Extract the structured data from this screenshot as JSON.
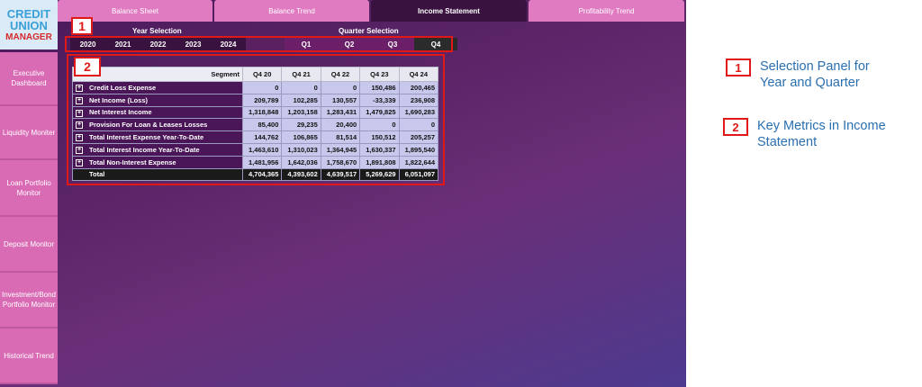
{
  "logo": {
    "line1": "CREDIT",
    "line2": "UNION",
    "line3": "MANAGER"
  },
  "tabs": [
    {
      "label": "Balance Sheet",
      "active": false
    },
    {
      "label": "Balance Trend",
      "active": false
    },
    {
      "label": "Income Statement",
      "active": true
    },
    {
      "label": "Profitability Trend",
      "active": false
    }
  ],
  "sidebar": [
    {
      "label": "Executive Dashboard"
    },
    {
      "label": "Liquidity Moniter"
    },
    {
      "label": "Loan Portfolio Monitor"
    },
    {
      "label": "Deposit Monitor"
    },
    {
      "label": "Investment/Bond Portfolio Monitor"
    },
    {
      "label": "Historical Trend"
    }
  ],
  "selection": {
    "year_title": "Year Selection",
    "quarter_title": "Quarter Selection",
    "years": [
      "2020",
      "2021",
      "2022",
      "2023",
      "2024"
    ],
    "quarters": [
      "Q1",
      "Q2",
      "Q3",
      "Q4"
    ],
    "selected_quarter": "Q4"
  },
  "callouts": {
    "one": "1",
    "two": "2"
  },
  "table": {
    "segment_header": "Segment",
    "columns": [
      "Q4 20",
      "Q4 21",
      "Q4 22",
      "Q4 23",
      "Q4 24"
    ],
    "rows": [
      {
        "label": "Credit Loss Expense",
        "values": [
          "0",
          "0",
          "0",
          "150,486",
          "200,465"
        ]
      },
      {
        "label": "Net Income (Loss)",
        "values": [
          "209,789",
          "102,285",
          "130,557",
          "-33,339",
          "236,908"
        ]
      },
      {
        "label": "Net Interest Income",
        "values": [
          "1,318,848",
          "1,203,158",
          "1,283,431",
          "1,479,825",
          "1,690,283"
        ]
      },
      {
        "label": "Provision For Loan & Leases Losses",
        "values": [
          "85,400",
          "29,235",
          "20,400",
          "0",
          "0"
        ]
      },
      {
        "label": "Total Interest Expense Year-To-Date",
        "values": [
          "144,762",
          "106,865",
          "81,514",
          "150,512",
          "205,257"
        ]
      },
      {
        "label": "Total Interest Income Year-To-Date",
        "values": [
          "1,463,610",
          "1,310,023",
          "1,364,945",
          "1,630,337",
          "1,895,540"
        ]
      },
      {
        "label": "Total Non-Interest Expense",
        "values": [
          "1,481,956",
          "1,642,036",
          "1,758,670",
          "1,891,808",
          "1,822,644"
        ]
      }
    ],
    "total": {
      "label": "Total",
      "values": [
        "4,704,365",
        "4,393,602",
        "4,639,517",
        "5,269,629",
        "6,051,097"
      ]
    }
  },
  "legend": [
    {
      "num": "1",
      "text": "Selection Panel for\nYear and Quarter"
    },
    {
      "num": "2",
      "text": "Key Metrics in Income\nStatement"
    }
  ],
  "colors": {
    "accent_pink": "#e07ac1",
    "callout_red": "#e01818",
    "legend_blue": "#2a6fb0"
  }
}
